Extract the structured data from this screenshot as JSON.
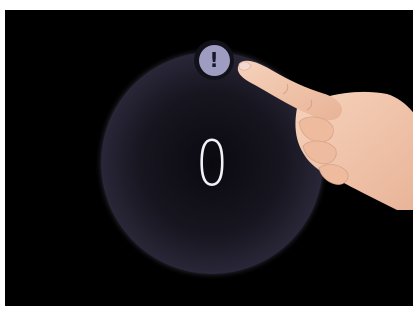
{
  "counter": {
    "value": "0"
  },
  "alert_button": {
    "icon": "exclamation-icon",
    "glyph": "!"
  },
  "colors": {
    "background": "#000000",
    "alert_fill": "#9f9cc2",
    "dial_rim": "#777190"
  }
}
